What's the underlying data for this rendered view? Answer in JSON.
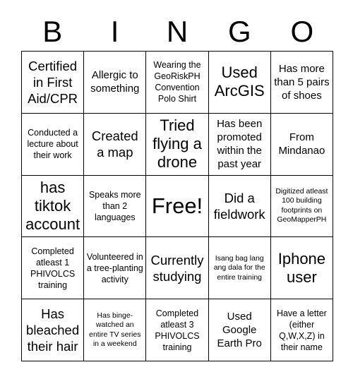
{
  "header": {
    "letters": [
      "B",
      "I",
      "N",
      "G",
      "O"
    ]
  },
  "colors": {
    "background": "#ffffff",
    "border": "#000000",
    "text": "#000000"
  },
  "grid": {
    "rows": 5,
    "columns": 5,
    "cells": [
      {
        "text": "Certified in First Aid/CPR",
        "size": "l"
      },
      {
        "text": "Allergic to something",
        "size": "m"
      },
      {
        "text": "Wearing the GeoRiskPH Convention Polo Shirt",
        "size": "s"
      },
      {
        "text": "Used ArcGIS",
        "size": "xl"
      },
      {
        "text": "Has more than 5 pairs of shoes",
        "size": "m"
      },
      {
        "text": "Conducted a lecture about their work",
        "size": "s"
      },
      {
        "text": "Created a map",
        "size": "l"
      },
      {
        "text": "Tried flying a drone",
        "size": "xl"
      },
      {
        "text": "Has been promoted within the past year",
        "size": "m"
      },
      {
        "text": "From Mindanao",
        "size": "m"
      },
      {
        "text": "has tiktok account",
        "size": "xl"
      },
      {
        "text": "Speaks more than 2 languages",
        "size": "s"
      },
      {
        "text": "Free!",
        "size": "xxl"
      },
      {
        "text": "Did a fieldwork",
        "size": "l"
      },
      {
        "text": "Digitized atleast 100 building footprints on GeoMapperPH",
        "size": "xs"
      },
      {
        "text": "Completed atleast 1 PHIVOLCS training",
        "size": "s"
      },
      {
        "text": "Volunteered in a tree-planting activity",
        "size": "s"
      },
      {
        "text": "Currently studying",
        "size": "l"
      },
      {
        "text": "Isang bag lang ang dala for the entire training",
        "size": "xs"
      },
      {
        "text": "Iphone user",
        "size": "xl"
      },
      {
        "text": "Has bleached their hair",
        "size": "l"
      },
      {
        "text": "Has binge-watched an entire TV series in a weekend",
        "size": "xs"
      },
      {
        "text": "Completed atleast 3 PHIVOLCS training",
        "size": "s"
      },
      {
        "text": "Used Google Earth Pro",
        "size": "m"
      },
      {
        "text": "Have a letter (either Q,W,X,Z) in their name",
        "size": "s"
      }
    ]
  }
}
